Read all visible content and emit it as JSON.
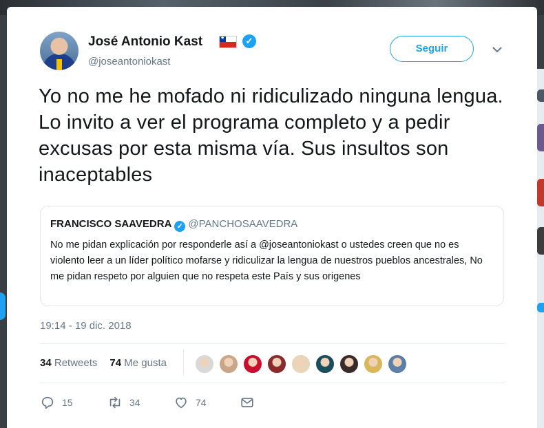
{
  "tweet": {
    "author_name": "José Antonio Kast",
    "author_handle": "@joseantoniokast",
    "follow_label": "Seguir",
    "text": "Yo no me he mofado ni ridiculizado ninguna lengua. Lo invito a ver el programa completo y a pedir excusas por esta misma vía. Sus insultos son inaceptables",
    "timestamp": "19:14 - 19 dic. 2018"
  },
  "quoted_tweet": {
    "author_name": "FRANCISCO SAAVEDRA",
    "author_handle": "@PANCHOSAAVEDRA",
    "text": "No me pidan explicación por responderle así a @joseantoniokast o ustedes creen que no es violento leer a un líder político mofarse y ridiculizar la lengua de nuestros pueblos ancestrales, No me pidan respeto por alguien que no respeta este País y sus origenes"
  },
  "stats": {
    "retweets_count": "34",
    "retweets_label": "Retweets",
    "likes_count": "74",
    "likes_label": "Me gusta"
  },
  "likers_avatars": [
    {
      "name": "liker-avatar-1",
      "color": "#d9d9d9"
    },
    {
      "name": "liker-avatar-2",
      "color": "#c9a58a"
    },
    {
      "name": "liker-avatar-3",
      "color": "#c8102e"
    },
    {
      "name": "liker-avatar-4",
      "color": "#8b2a2a"
    },
    {
      "name": "liker-avatar-5",
      "color": "#e8d6b8"
    },
    {
      "name": "liker-avatar-6",
      "color": "#1a4d5c"
    },
    {
      "name": "liker-avatar-7",
      "color": "#3a2a2a"
    },
    {
      "name": "liker-avatar-8",
      "color": "#d9b85c"
    },
    {
      "name": "liker-avatar-9",
      "color": "#5b7fa6"
    }
  ],
  "actions": {
    "reply_count": "15",
    "retweet_count": "34",
    "like_count": "74"
  },
  "icons": [
    "flag-chile-icon",
    "verified-icon",
    "chevron-down-icon",
    "reply-icon",
    "retweet-icon",
    "heart-icon",
    "message-icon"
  ],
  "colors": {
    "accent": "#1da1f2",
    "secondary_text": "#657786",
    "primary_text": "#14171a",
    "border": "#e1e8ed"
  }
}
